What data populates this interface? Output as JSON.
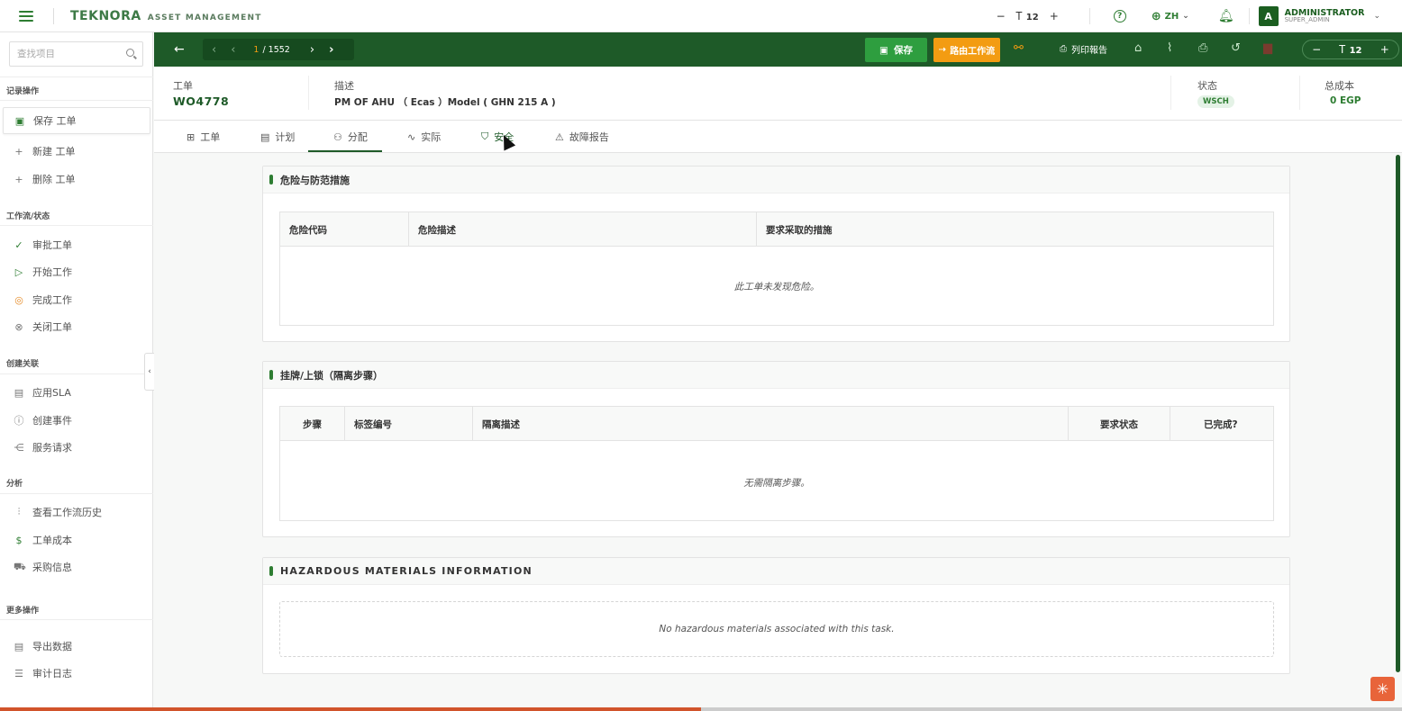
{
  "topbar": {
    "brand": "TEKNORA",
    "brand_sub": "ASSET MANAGEMENT",
    "font_size": "12",
    "font_minus": "−",
    "font_plus": "+",
    "lang": "ZH",
    "user_initial": "A",
    "user_name": "ADMINISTRATOR",
    "user_role": "SUPER_ADMIN"
  },
  "sidebar": {
    "search_placeholder": "查找项目",
    "sections": {
      "record": "记录操作",
      "workflow": "工作流/状态",
      "links": "创建关联",
      "analysis": "分析",
      "more": "更多操作"
    },
    "items": {
      "save": "保存 工单",
      "new": "新建 工单",
      "delete": "删除 工单",
      "approve": "审批工单",
      "start": "开始工作",
      "complete": "完成工作",
      "close": "关闭工单",
      "sla": "应用SLA",
      "event": "创建事件",
      "service": "服务请求",
      "history": "查看工作流历史",
      "cost": "工单成本",
      "purchase": "采购信息",
      "export": "导出数据",
      "audit": "审计日志"
    }
  },
  "toolbar": {
    "page_current": "1",
    "page_total": "/ 1552",
    "save_label": "保存",
    "route_label": "路由工作流",
    "report_label": "列印報告",
    "font_size": "12"
  },
  "header": {
    "wo_label": "工单",
    "wo_value": "WO4778",
    "desc_label": "描述",
    "desc_value": "PM OF AHU （ Ecas ）Model ( GHN 215 A )",
    "status_label": "状态",
    "status_value": "WSCH",
    "cost_label": "总成本",
    "cost_value": "0 EGP"
  },
  "tabs": {
    "t1": "工单",
    "t2": "计划",
    "t3": "分配",
    "t4": "实际",
    "t5": "安全",
    "t6": "故障报告"
  },
  "hazards": {
    "title": "危险与防范措施",
    "col1": "危险代码",
    "col2": "危险描述",
    "col3": "要求采取的措施",
    "empty": "此工单未发现危险。"
  },
  "lockout": {
    "title": "挂牌/上锁（隔离步骤）",
    "col1": "步骤",
    "col2": "标签编号",
    "col3": "隔离描述",
    "col4": "要求状态",
    "col5": "已完成?",
    "empty": "无需隔离步骤。"
  },
  "hazmat": {
    "title": "HAZARDOUS MATERIALS INFORMATION",
    "empty": "No hazardous materials associated with this task."
  },
  "progress": 0.5,
  "colors": {
    "primary": "#1e5a28",
    "save": "#2e9e3f",
    "route": "#f39c12",
    "progress": "#d1542b"
  }
}
